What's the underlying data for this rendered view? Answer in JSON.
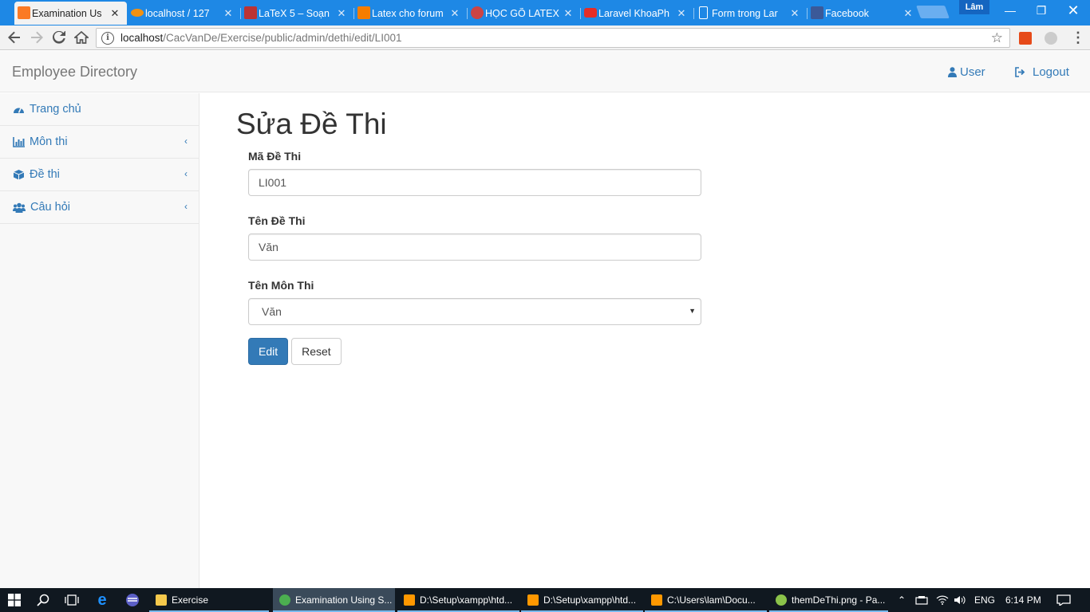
{
  "browser": {
    "tabs": [
      {
        "title": "Examination Us",
        "icon": "xampp-icon",
        "color": "#fb7a24",
        "active": true
      },
      {
        "title": "localhost / 127",
        "icon": "phpmyadmin-icon",
        "color": "#f29111"
      },
      {
        "title": "LaTeX 5 – Soạn",
        "icon": "latex-icon",
        "color": "#b33"
      },
      {
        "title": "Latex cho forum",
        "icon": "blogger-icon",
        "color": "#f57d00"
      },
      {
        "title": "HỌC GÕ LATEX",
        "icon": "forum-icon",
        "color": "#c44"
      },
      {
        "title": "Laravel KhoaPh",
        "icon": "youtube-icon",
        "color": "#e52d27"
      },
      {
        "title": "Form trong Lar",
        "icon": "document-icon",
        "color": "#ffffff"
      },
      {
        "title": "Facebook",
        "icon": "facebook-icon",
        "color": "#3b5998"
      }
    ],
    "profile_name": "Lâm",
    "url_host": "localhost",
    "url_path": "/CacVanDe/Exercise/public/admin/dethi/edit/LI001"
  },
  "app": {
    "brand": "Employee Directory",
    "user_label": "User",
    "logout_label": "Logout"
  },
  "sidebar": {
    "items": [
      {
        "label": "Trang chủ",
        "icon": "dashboard-icon"
      },
      {
        "label": "Môn thi",
        "icon": "bar-chart-icon"
      },
      {
        "label": "Đề thi",
        "icon": "cube-icon"
      },
      {
        "label": "Câu hỏi",
        "icon": "users-icon"
      }
    ]
  },
  "main": {
    "title": "Sửa Đề Thi",
    "fields": {
      "code_label": "Mã Đề Thi",
      "code_value": "LI001",
      "name_label": "Tên Đề Thi",
      "name_value": "Văn",
      "subject_label": "Tên Môn Thi",
      "subject_value": "Văn"
    },
    "edit_button": "Edit",
    "reset_button": "Reset"
  },
  "taskbar": {
    "items": [
      {
        "label": "Exercise"
      },
      {
        "label": "Examination Using S..."
      },
      {
        "label": "D:\\Setup\\xampp\\htd..."
      },
      {
        "label": "D:\\Setup\\xampp\\htd..."
      },
      {
        "label": "C:\\Users\\lam\\Docu..."
      },
      {
        "label": "themDeThi.png - Pa..."
      }
    ],
    "language": "ENG",
    "time": "6:14 PM"
  }
}
